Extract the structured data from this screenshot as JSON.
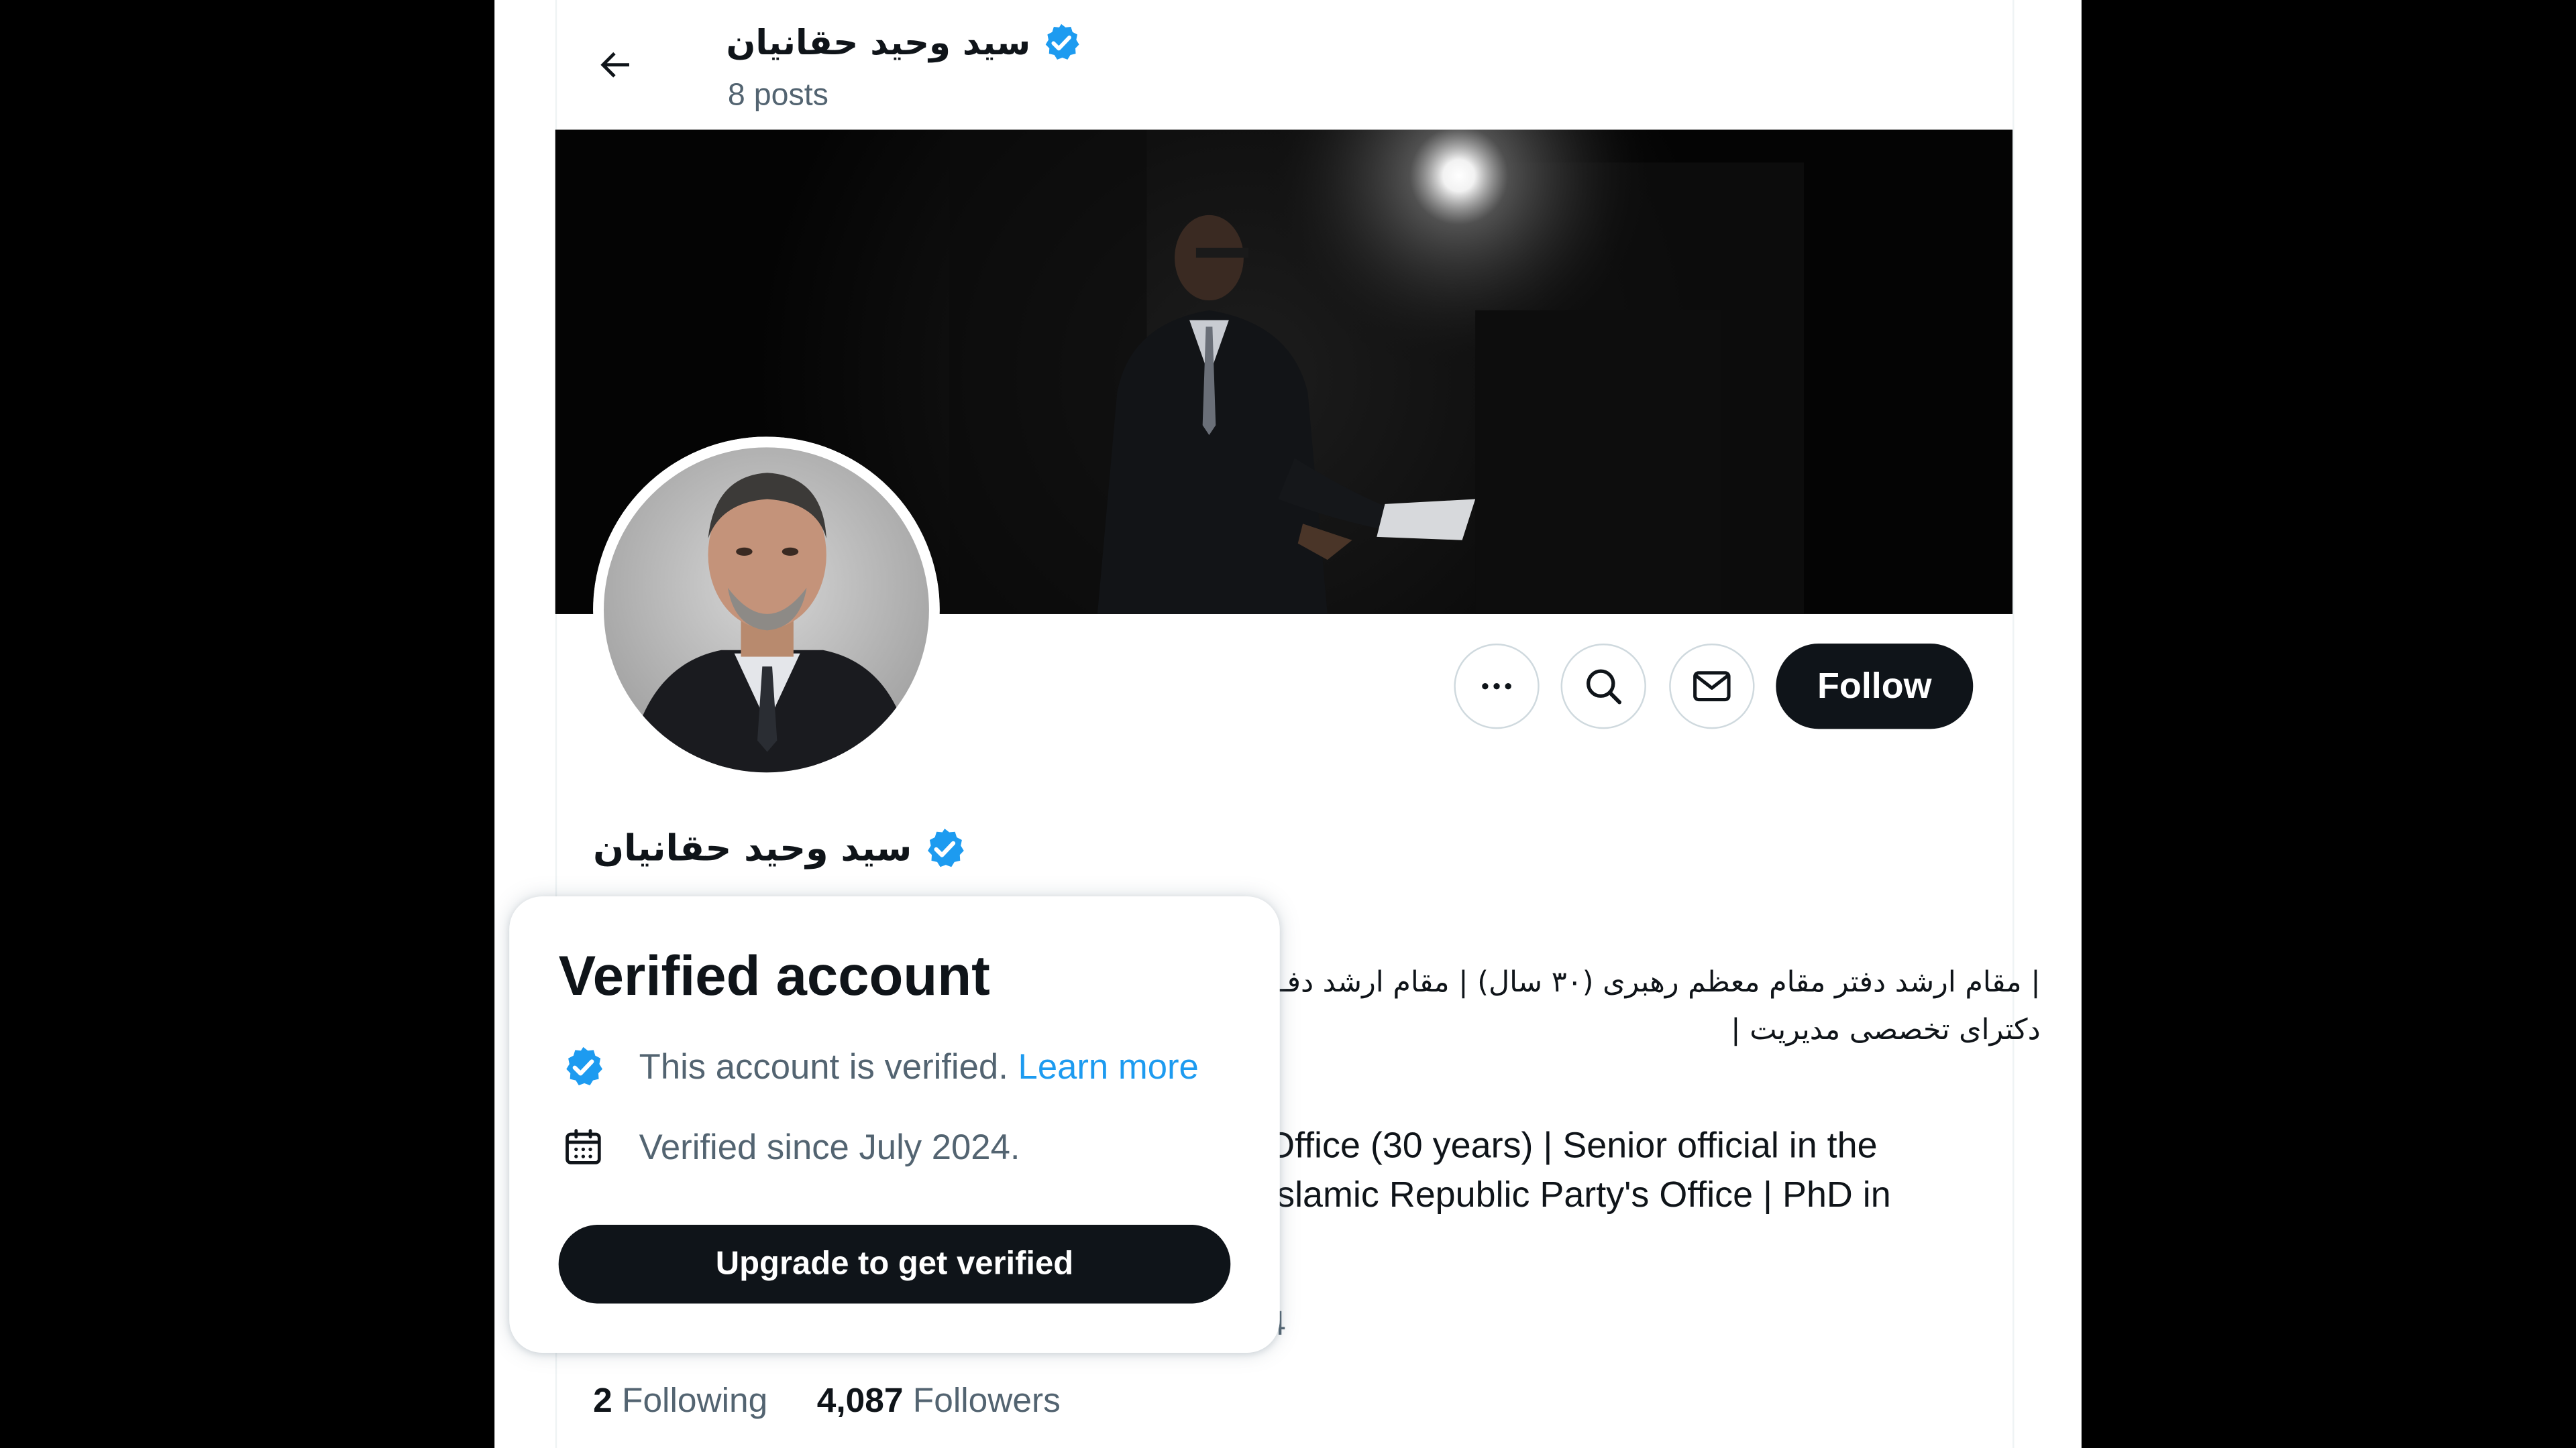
{
  "header": {
    "display_name": "سید وحید حقانیان",
    "posts_count": "8 posts"
  },
  "actions": {
    "follow_label": "Follow"
  },
  "profile": {
    "display_name": "سید وحید حقانیان",
    "bio_fa_line1": "| مقام ارشد دفتر مقام معظم رهبری (۳۰ سال) | مقام ارشد دفـ",
    "bio_fa_line2": "دکترای تخصصی مدیریت |",
    "bio_en_line1": "Office (30 years) | Senior official in the",
    "bio_en_line2": "Islamic Republic Party's Office | PhD in",
    "joined_peek": "4",
    "following_count": "2",
    "following_label": "Following",
    "followers_count": "4,087",
    "followers_label": "Followers"
  },
  "hovercard": {
    "title": "Verified account",
    "verified_text": "This account is verified.",
    "learn_more": "Learn more",
    "since_text": "Verified since July 2024.",
    "upgrade_button": "Upgrade to get verified"
  },
  "colors": {
    "accent": "#1d9bf0",
    "text_primary": "#0f1419",
    "text_secondary": "#536471",
    "button_dark": "#0f1419"
  },
  "icons": [
    "back-arrow-icon",
    "verified-badge-icon",
    "more-icon",
    "search-icon",
    "mail-icon",
    "calendar-icon"
  ]
}
